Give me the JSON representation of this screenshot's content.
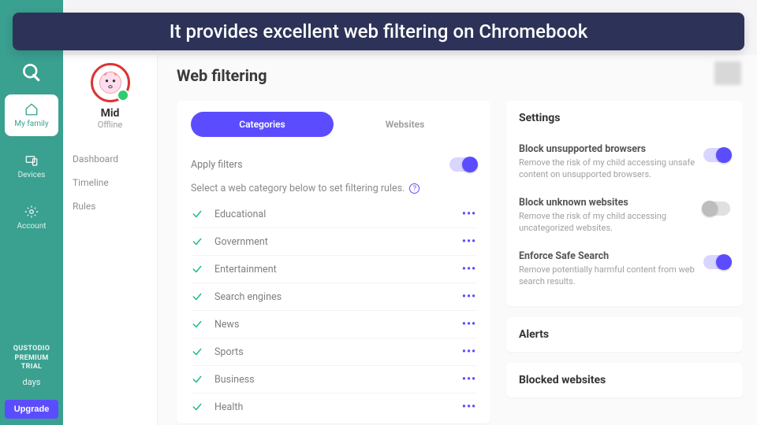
{
  "banner": {
    "text": "It provides excellent web filtering on Chromebook"
  },
  "sidebar": {
    "items": [
      {
        "label": "My family"
      },
      {
        "label": "Devices"
      },
      {
        "label": "Account"
      }
    ],
    "trial_line1": "QUSTODIO",
    "trial_line2": "PREMIUM",
    "trial_line3": "TRIAL",
    "trial_days": "days",
    "upgrade_label": "Upgrade"
  },
  "profile": {
    "name": "Mid",
    "status": "Offline",
    "links": [
      {
        "label": "Dashboard"
      },
      {
        "label": "Timeline"
      },
      {
        "label": "Rules"
      }
    ]
  },
  "page": {
    "title": "Web filtering"
  },
  "tabs": {
    "categories": "Categories",
    "websites": "Websites"
  },
  "filters": {
    "apply_label": "Apply filters",
    "apply_on": true,
    "instruction": "Select a web category below to set filtering rules.",
    "categories": [
      {
        "name": "Educational"
      },
      {
        "name": "Government"
      },
      {
        "name": "Entertainment"
      },
      {
        "name": "Search engines"
      },
      {
        "name": "News"
      },
      {
        "name": "Sports"
      },
      {
        "name": "Business"
      },
      {
        "name": "Health"
      }
    ]
  },
  "settings": {
    "title": "Settings",
    "items": [
      {
        "label": "Block unsupported browsers",
        "desc": "Remove the risk of my child accessing unsafe content on unsupported browsers.",
        "on": true
      },
      {
        "label": "Block unknown websites",
        "desc": "Remove the risk of my child accessing uncategorized websites.",
        "on": false
      },
      {
        "label": "Enforce Safe Search",
        "desc": "Remove potentially harmful content from web search results.",
        "on": true
      }
    ]
  },
  "alerts": {
    "title": "Alerts"
  },
  "blocked": {
    "title": "Blocked websites"
  }
}
